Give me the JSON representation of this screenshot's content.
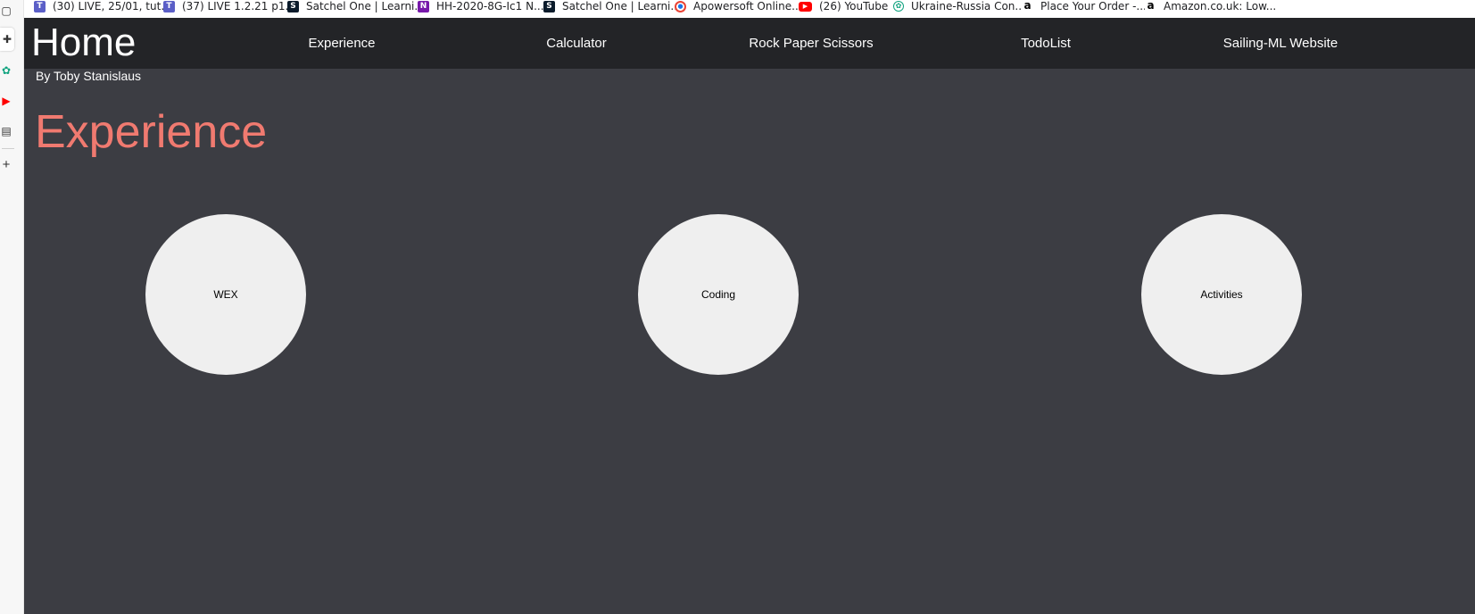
{
  "bookmarks": [
    {
      "label": "(30) LIVE, 25/01, tut...",
      "icon": "teams-icon"
    },
    {
      "label": "(37) LIVE 1.2.21 p1...",
      "icon": "teams-icon"
    },
    {
      "label": "Satchel One | Learni...",
      "icon": "satchel-icon"
    },
    {
      "label": "HH-2020-8G-Ic1 N...",
      "icon": "onenote-icon"
    },
    {
      "label": "Satchel One | Learni...",
      "icon": "satchel-icon"
    },
    {
      "label": "Apowersoft Online...",
      "icon": "apowersoft-icon"
    },
    {
      "label": "(26) YouTube",
      "icon": "youtube-icon"
    },
    {
      "label": "Ukraine-Russia Con...",
      "icon": "chatgpt-icon"
    },
    {
      "label": "Place Your Order -...",
      "icon": "amazon-icon"
    },
    {
      "label": "Amazon.co.uk: Low...",
      "icon": "amazon-icon"
    }
  ],
  "sidebar_icons": [
    "tabs-icon",
    "extensions-icon",
    "chatgpt-icon",
    "youtube-icon",
    "calendar-icon",
    "add-icon"
  ],
  "site": {
    "home": "Home",
    "nav": [
      "Experience",
      "Calculator",
      "Rock Paper Scissors",
      "TodoList",
      "Sailing-ML Website"
    ],
    "byline": "By Toby Stanislaus",
    "heading": "Experience",
    "circles": [
      "WEX",
      "Coding",
      "Activities"
    ]
  },
  "colors": {
    "page_bg": "#3c3d43",
    "navbar_bg": "#232427",
    "heading": "#f07a70",
    "circle_bg": "#efefef"
  }
}
